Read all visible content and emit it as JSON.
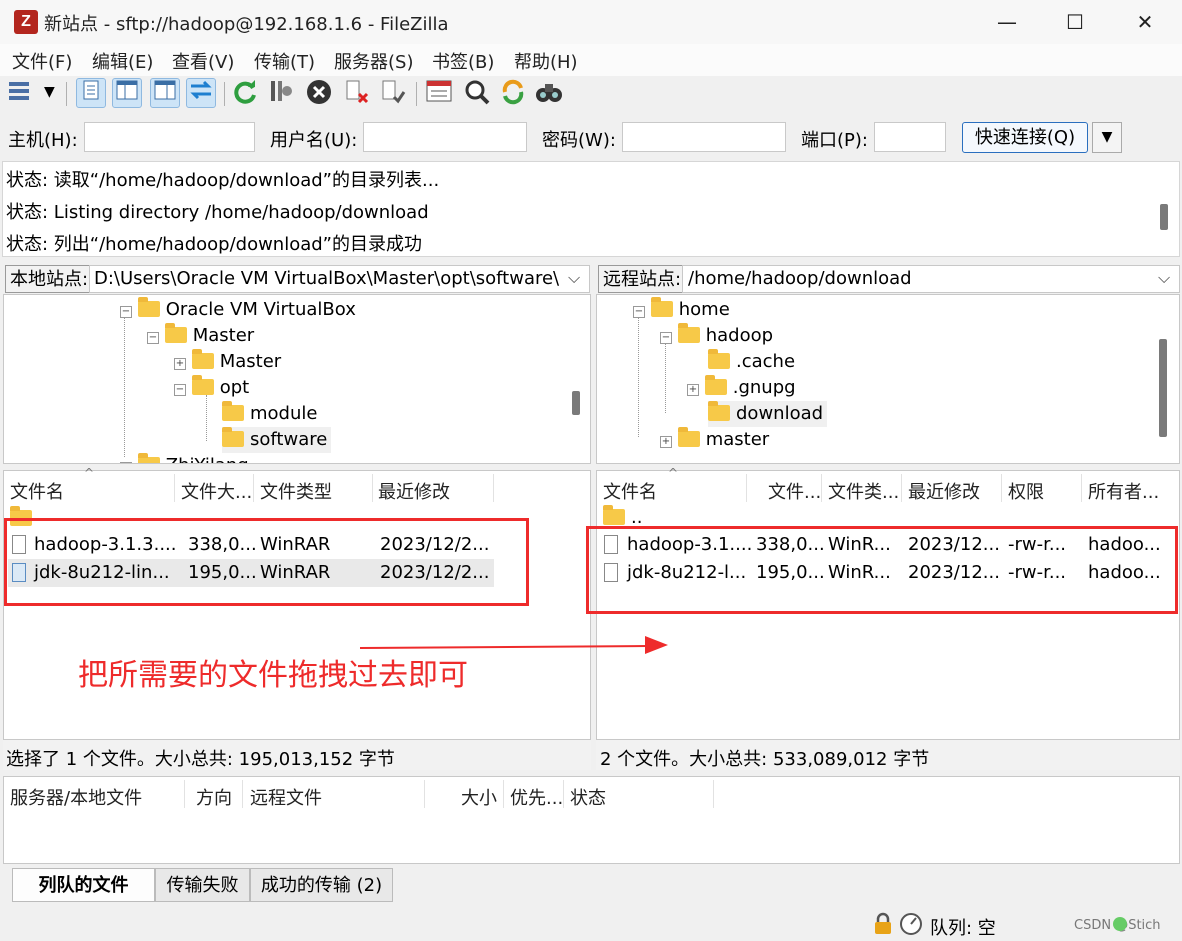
{
  "window": {
    "title": "新站点 - sftp://hadoop@192.168.1.6 - FileZilla",
    "app_icon": "Z",
    "controls": [
      "—",
      "☐",
      "✕"
    ]
  },
  "menu": [
    "文件(F)",
    "编辑(E)",
    "查看(V)",
    "传输(T)",
    "服务器(S)",
    "书签(B)",
    "帮助(H)"
  ],
  "quickconnect": {
    "host_label": "主机(H):",
    "host_value": "",
    "user_label": "用户名(U):",
    "user_value": "",
    "pass_label": "密码(W):",
    "pass_value": "",
    "port_label": "端口(P):",
    "port_value": "",
    "connect_label": "快速连接(Q)"
  },
  "log": [
    "状态: 读取“/home/hadoop/download”的目录列表...",
    "状态: Listing directory /home/hadoop/download",
    "状态: 列出“/home/hadoop/download”的目录成功"
  ],
  "local": {
    "site_label": "本地站点:",
    "path": "D:\\Users\\Oracle VM VirtualBox\\Master\\opt\\software\\",
    "tree": [
      {
        "label": "Oracle VM VirtualBox",
        "expander": "−"
      },
      {
        "label": "Master",
        "expander": "−"
      },
      {
        "label": "Master",
        "expander": "+"
      },
      {
        "label": "opt",
        "expander": "−"
      },
      {
        "label": "module",
        "expander": ""
      },
      {
        "label": "software",
        "expander": ""
      },
      {
        "label": "ZhiYilang",
        "expander": "+"
      }
    ],
    "headers": [
      "文件名",
      "文件大...",
      "文件类型",
      "最近修改"
    ],
    "files": [
      {
        "name": "hadoop-3.1.3....",
        "size": "338,0...",
        "type": "WinRAR",
        "modified": "2023/12/2..."
      },
      {
        "name": "jdk-8u212-lin...",
        "size": "195,0...",
        "type": "WinRAR",
        "modified": "2023/12/2..."
      }
    ],
    "status": "选择了 1 个文件。大小总共: 195,013,152 字节"
  },
  "remote": {
    "site_label": "远程站点:",
    "path": "/home/hadoop/download",
    "tree": [
      {
        "label": "home",
        "expander": "−"
      },
      {
        "label": "hadoop",
        "expander": "−"
      },
      {
        "label": ".cache",
        "expander": ""
      },
      {
        "label": ".gnupg",
        "expander": "+"
      },
      {
        "label": "download",
        "expander": ""
      },
      {
        "label": "master",
        "expander": "+"
      }
    ],
    "headers": [
      "文件名",
      "文件...",
      "文件类...",
      "最近修改",
      "权限",
      "所有者..."
    ],
    "parent_dir": "..",
    "files": [
      {
        "name": "hadoop-3.1....",
        "size": "338,0...",
        "type": "WinR...",
        "modified": "2023/12...",
        "perm": "-rw-r...",
        "owner": "hadoo..."
      },
      {
        "name": "jdk-8u212-l...",
        "size": "195,0...",
        "type": "WinR...",
        "modified": "2023/12...",
        "perm": "-rw-r...",
        "owner": "hadoo..."
      }
    ],
    "status": "2 个文件。大小总共: 533,089,012 字节"
  },
  "annotation": "把所需要的文件拖拽过去即可",
  "queue": {
    "headers": [
      "服务器/本地文件",
      "方向",
      "远程文件",
      "大小",
      "优先...",
      "状态"
    ],
    "tabs": [
      "列队的文件",
      "传输失败",
      "成功的传输 (2)"
    ]
  },
  "statusbar": {
    "queue": "队列: 空",
    "watermark": "CSDN @Stich"
  },
  "colors": {
    "accent_red": "#ee2b2b",
    "selection": "#cde4f7",
    "folder": "#f7c948"
  }
}
